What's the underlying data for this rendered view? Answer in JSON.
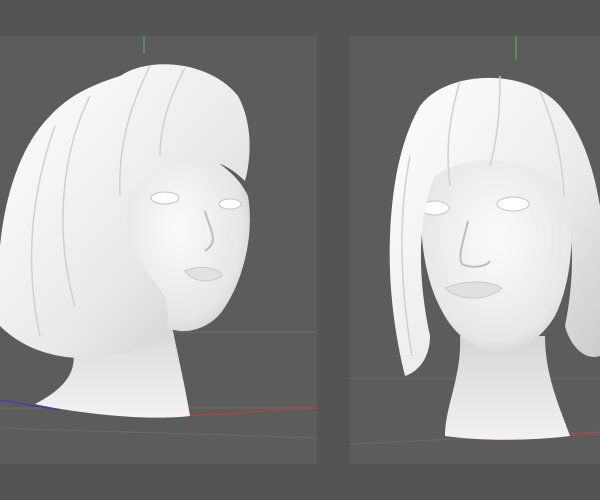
{
  "app": {
    "title": "",
    "viewport_background": "#5c5c5c",
    "frame_color": "#545454"
  },
  "viewports": [
    {
      "name": "left-viewport",
      "view": "three-quarter",
      "subject": "head-bust-model",
      "material_color": "#f2f2f2",
      "axis_colors": {
        "x": "#c23b3b",
        "y": "#3ea845",
        "z": "#3b3bc2"
      }
    },
    {
      "name": "right-viewport",
      "view": "front",
      "subject": "head-bust-model",
      "material_color": "#f2f2f2",
      "axis_colors": {
        "x": "#c23b3b",
        "y": "#3ea845",
        "z": "#3b3bc2"
      }
    }
  ],
  "icons": {
    "axis_gizmo": "axis-gizmo-icon"
  }
}
